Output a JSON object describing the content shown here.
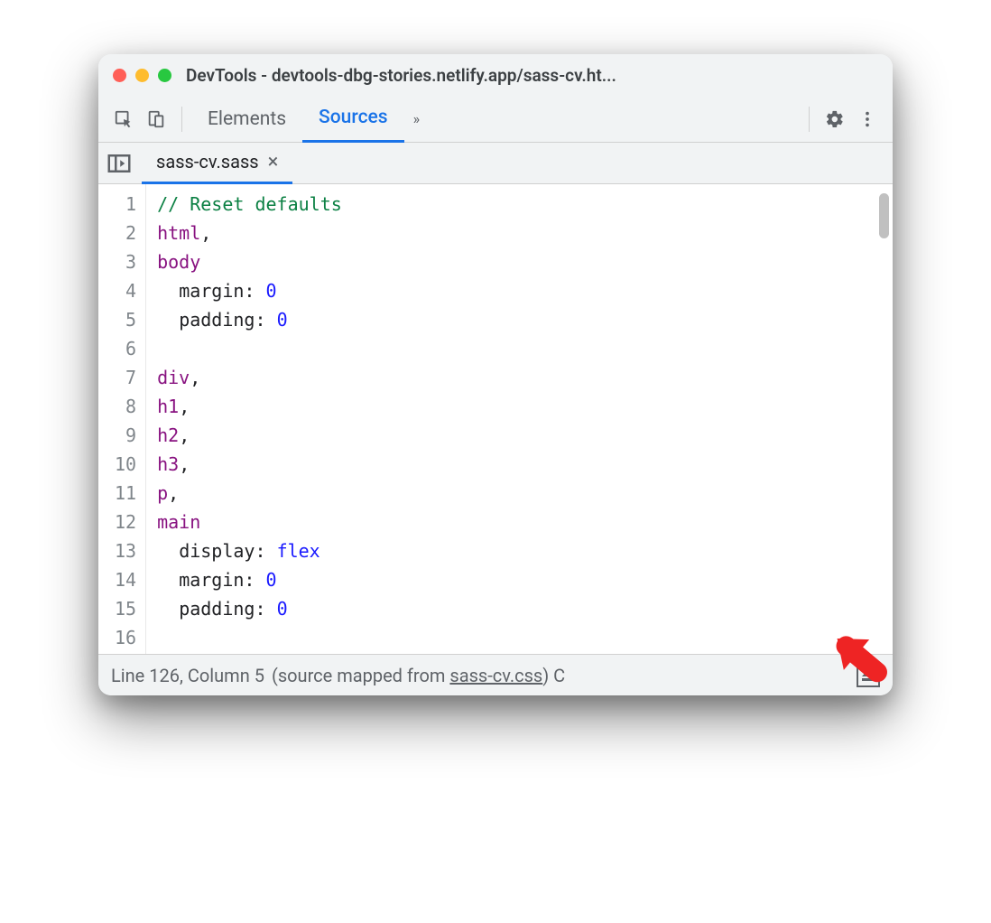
{
  "window": {
    "title": "DevTools - devtools-dbg-stories.netlify.app/sass-cv.ht..."
  },
  "toolbar": {
    "tabs": [
      "Elements",
      "Sources"
    ],
    "activeTab": "Sources",
    "overflowGlyph": "»"
  },
  "fileTab": {
    "name": "sass-cv.sass",
    "close": "×"
  },
  "code": {
    "lines": [
      {
        "n": 1,
        "seg": [
          {
            "cls": "c-comment",
            "t": "// Reset defaults"
          }
        ]
      },
      {
        "n": 2,
        "seg": [
          {
            "cls": "c-tag",
            "t": "html"
          },
          {
            "cls": "c-punc",
            "t": ","
          }
        ]
      },
      {
        "n": 3,
        "seg": [
          {
            "cls": "c-tag",
            "t": "body"
          }
        ]
      },
      {
        "n": 4,
        "seg": [
          {
            "cls": "",
            "t": "  "
          },
          {
            "cls": "c-prop",
            "t": "margin: "
          },
          {
            "cls": "c-val",
            "t": "0"
          }
        ]
      },
      {
        "n": 5,
        "seg": [
          {
            "cls": "",
            "t": "  "
          },
          {
            "cls": "c-prop",
            "t": "padding: "
          },
          {
            "cls": "c-val",
            "t": "0"
          }
        ]
      },
      {
        "n": 6,
        "seg": [
          {
            "cls": "",
            "t": ""
          }
        ]
      },
      {
        "n": 7,
        "seg": [
          {
            "cls": "c-tag",
            "t": "div"
          },
          {
            "cls": "c-punc",
            "t": ","
          }
        ]
      },
      {
        "n": 8,
        "seg": [
          {
            "cls": "c-tag",
            "t": "h1"
          },
          {
            "cls": "c-punc",
            "t": ","
          }
        ]
      },
      {
        "n": 9,
        "seg": [
          {
            "cls": "c-tag",
            "t": "h2"
          },
          {
            "cls": "c-punc",
            "t": ","
          }
        ]
      },
      {
        "n": 10,
        "seg": [
          {
            "cls": "c-tag",
            "t": "h3"
          },
          {
            "cls": "c-punc",
            "t": ","
          }
        ]
      },
      {
        "n": 11,
        "seg": [
          {
            "cls": "c-tag",
            "t": "p"
          },
          {
            "cls": "c-punc",
            "t": ","
          }
        ]
      },
      {
        "n": 12,
        "seg": [
          {
            "cls": "c-tag",
            "t": "main"
          }
        ]
      },
      {
        "n": 13,
        "seg": [
          {
            "cls": "",
            "t": "  "
          },
          {
            "cls": "c-prop",
            "t": "display: "
          },
          {
            "cls": "c-val",
            "t": "flex"
          }
        ]
      },
      {
        "n": 14,
        "seg": [
          {
            "cls": "",
            "t": "  "
          },
          {
            "cls": "c-prop",
            "t": "margin: "
          },
          {
            "cls": "c-val",
            "t": "0"
          }
        ]
      },
      {
        "n": 15,
        "seg": [
          {
            "cls": "",
            "t": "  "
          },
          {
            "cls": "c-prop",
            "t": "padding: "
          },
          {
            "cls": "c-val",
            "t": "0"
          }
        ]
      },
      {
        "n": 16,
        "seg": [
          {
            "cls": "",
            "t": ""
          }
        ]
      }
    ]
  },
  "status": {
    "cursor": "Line 126, Column 5",
    "mappedPrefix": "(source mapped from ",
    "mappedFile": "sass-cv.css",
    "mappedSuffix": ")",
    "trailing": " C"
  }
}
